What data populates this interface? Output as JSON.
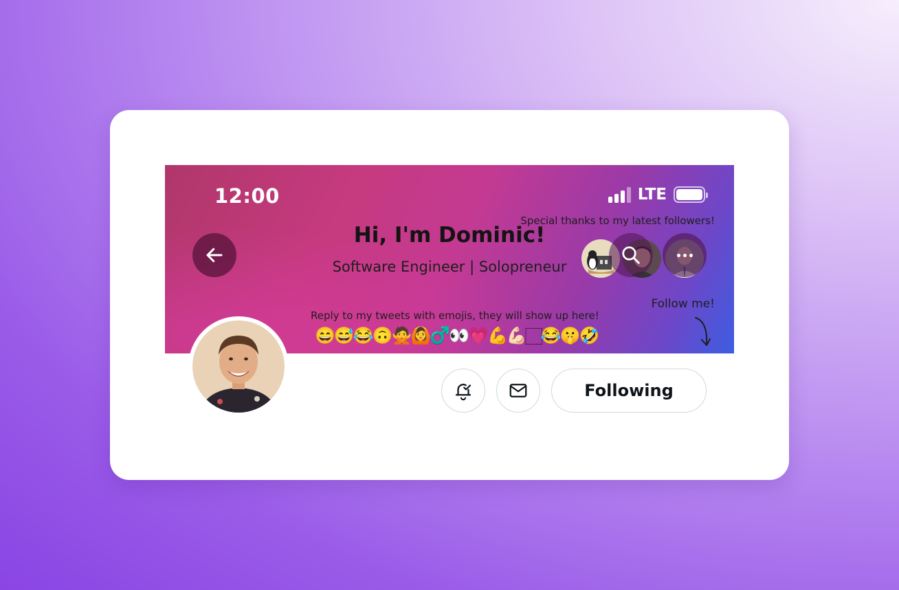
{
  "banner": {
    "clock": "12:00",
    "network": "LTE",
    "headline": "Hi, I'm Dominic!",
    "subline": "Software Engineer | Solopreneur",
    "thanks_note": "Special thanks to my latest followers!",
    "reply_note": "Reply to my tweets with emojis, they will show up here!",
    "emojis": "😄😅😂🙃🙅🙆♂️👀💗💪💪🏻🏻😂🤫🤣",
    "follow_note": "Follow me!"
  },
  "icons": {
    "back": "arrow-left-icon",
    "search": "search-icon",
    "more": "more-horizontal-icon",
    "notifications": "bell-check-icon",
    "message": "envelope-icon"
  },
  "actions": {
    "following_label": "Following"
  },
  "colors": {
    "banner_start": "#b0376a",
    "banner_mid": "#c43a92",
    "banner_end": "#3d5de2",
    "background": "#9a5be8"
  }
}
